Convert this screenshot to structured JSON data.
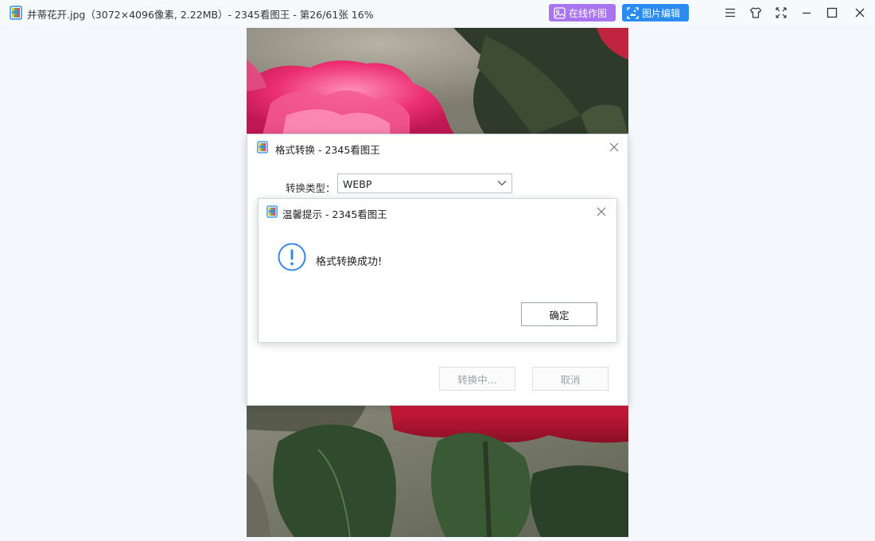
{
  "window": {
    "title": "并蒂花开.jpg（3072×4096像素, 2.22MB）- 2345看图王 - 第26/61张 16%",
    "buttons": {
      "online_edit": "在线作图",
      "image_edit": "图片编辑"
    },
    "controls": [
      "menu-icon",
      "skin-icon",
      "fullscreen-icon",
      "minimize-icon",
      "maximize-icon",
      "close-icon"
    ]
  },
  "colors": {
    "online_pill": "#a874f0",
    "edit_pill": "#2a8cf0",
    "info_icon": "#3a86e8"
  },
  "convert_dialog": {
    "title": "格式转换 - 2345看图王",
    "type_label": "转换类型：",
    "type_value": "WEBP",
    "converting_button": "转换中...",
    "cancel_button": "取消"
  },
  "tip_dialog": {
    "title": "温馨提示 - 2345看图王",
    "message": "格式转换成功!",
    "ok_button": "确定"
  }
}
